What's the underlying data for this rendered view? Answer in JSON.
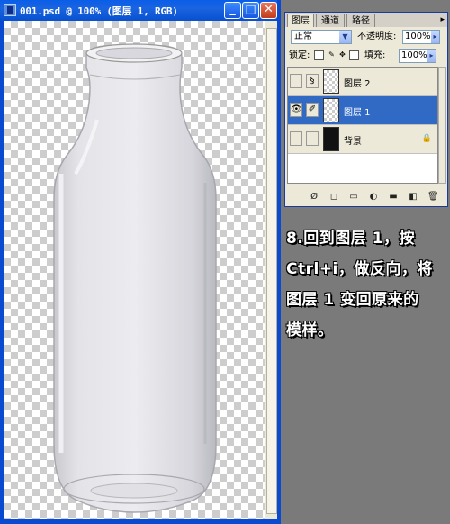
{
  "window": {
    "title": "001.psd @ 100% (图层 1, RGB)",
    "min_label": "_",
    "max_label": "□",
    "close_label": "✕"
  },
  "palette": {
    "tabs": [
      "图层",
      "通道",
      "路径"
    ],
    "blend_mode": "正常",
    "opacity_label": "不透明度:",
    "opacity_value": "100%",
    "lock_label": "锁定:",
    "fill_label": "填充:",
    "fill_value": "100%",
    "layers": [
      {
        "name": "图层 2",
        "visible": false,
        "selected": false
      },
      {
        "name": "图层 1",
        "visible": true,
        "selected": true
      },
      {
        "name": "背景",
        "visible": false,
        "selected": false,
        "locked": true
      }
    ],
    "bottom_icons": [
      "link-icon",
      "style-icon",
      "mask-icon",
      "adjust-icon",
      "group-icon",
      "new-layer-icon",
      "trash-icon"
    ]
  },
  "note": {
    "lines": [
      "8.回到图层 1，按",
      "Ctrl+i，做反向，将",
      "图层 1 变回原来的",
      "模样。"
    ]
  },
  "colors": {
    "titlebar": "#0a5ee8",
    "selected_layer": "#316ac5",
    "background": "#7a7a7a"
  }
}
